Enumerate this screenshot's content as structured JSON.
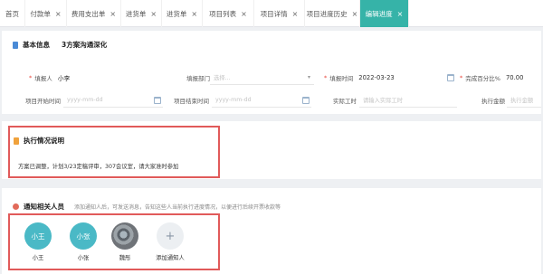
{
  "tabs": [
    {
      "label": "首页",
      "closable": false,
      "active": false
    },
    {
      "label": "付款单",
      "closable": true,
      "active": false
    },
    {
      "label": "费用支出单",
      "closable": true,
      "active": false
    },
    {
      "label": "进货单",
      "closable": true,
      "active": false
    },
    {
      "label": "进货单",
      "closable": true,
      "active": false
    },
    {
      "label": "项目列表",
      "closable": true,
      "active": false
    },
    {
      "label": "项目详情",
      "closable": true,
      "active": false
    },
    {
      "label": "项目进度历史",
      "closable": true,
      "active": false
    },
    {
      "label": "编辑进度",
      "closable": true,
      "active": true
    }
  ],
  "close_glyph": "×",
  "basic": {
    "title": "基本信息",
    "project_name": "3方案沟通深化",
    "reporter_label": "填报人",
    "reporter_value": "小李",
    "dept_label": "填报部门",
    "dept_placeholder": "选择...",
    "date_label": "填报时间",
    "date_value": "2022-03-23",
    "percent_label": "完成百分比%",
    "percent_value": "70.00",
    "start_label": "项目开始时间",
    "start_placeholder": "yyyy-mm-dd",
    "end_label": "项目结束时间",
    "end_placeholder": "yyyy-mm-dd",
    "hours_label": "实际工时",
    "hours_placeholder": "请输入实际工时",
    "amount_label": "执行金额",
    "amount_placeholder": "执行金额"
  },
  "execution": {
    "title": "执行情况说明",
    "text": "方案已调整，计划3/23定稿评审，307会议室，请大家准时参加"
  },
  "notify": {
    "title": "通知相关人员",
    "hint": "添加通知人后，可发送消息，告知这些人当前执行进度情况，以便进行后续开票收款等",
    "people": [
      {
        "avatar_text": "小王",
        "name": "小王",
        "kind": "teal"
      },
      {
        "avatar_text": "小张",
        "name": "小张",
        "kind": "teal"
      },
      {
        "avatar_text": "",
        "name": "魏彤",
        "kind": "photo"
      },
      {
        "avatar_text": "+",
        "name": "添加通知人",
        "kind": "add"
      }
    ]
  },
  "colors": {
    "accent": "#36b3a8",
    "avatar": "#4ab9c6",
    "highlight_frame": "#e15a5a",
    "required": "#e8443a"
  }
}
